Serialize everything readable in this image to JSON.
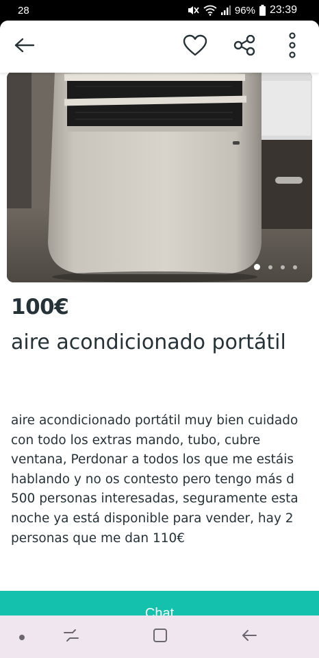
{
  "status_bar": {
    "notification_count": "28",
    "battery": "96%",
    "time": "23:39"
  },
  "top_bar": {
    "icons": [
      "back-arrow-icon",
      "heart-icon",
      "share-icon",
      "more-vertical-icon"
    ]
  },
  "gallery": {
    "photo_count": 4,
    "active_index": 0
  },
  "listing": {
    "price": "100€",
    "title": "aire acondicionado portátil",
    "description": "aire acondicionado portátil muy bien cuidado con todo los extras mando, tubo, cubre ventana, Perdonar a todos los que me estáis hablando y no os contesto pero tengo más d 500 personas interesadas, seguramente esta noche ya está disponible para vender, hay 2 personas que me dan 110€"
  },
  "actions": {
    "chat_label": "Chat"
  },
  "nav_bar": {
    "icons": [
      "dot-icon",
      "recent-apps-icon",
      "home-square-icon",
      "back-icon"
    ]
  },
  "colors": {
    "accent": "#13c1ac",
    "text": "#253238",
    "nav_background": "#f0e6f0"
  }
}
